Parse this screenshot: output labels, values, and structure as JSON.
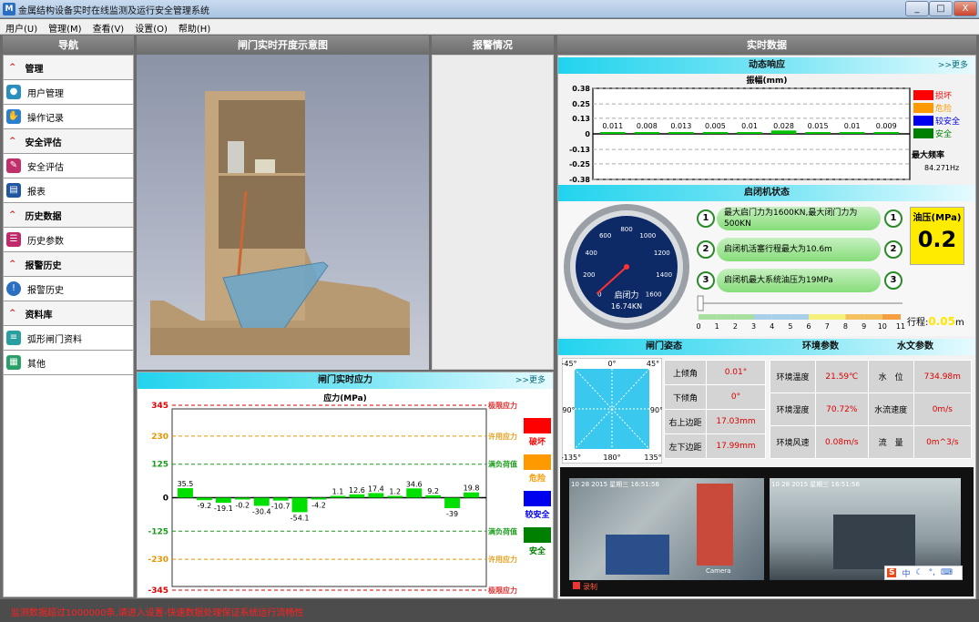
{
  "window": {
    "title": "金属结构设备实时在线监测及运行安全管理系统",
    "app_icon": "M",
    "min": "_",
    "max": "□",
    "close": "X"
  },
  "menu": [
    "用户(U)",
    "管理(M)",
    "查看(V)",
    "设置(O)",
    "帮助(H)"
  ],
  "headers": {
    "nav": "导航",
    "scene": "闸门实时开度示意图",
    "alarm": "报警情况",
    "realtime": "实时数据"
  },
  "nav": {
    "sections": [
      {
        "title": "管理",
        "items": [
          {
            "label": "用户管理",
            "icon": "user-icon"
          },
          {
            "label": "操作记录",
            "icon": "record-icon"
          }
        ]
      },
      {
        "title": "安全评估",
        "items": [
          {
            "label": "安全评估",
            "icon": "pencil-icon"
          }
        ]
      },
      {
        "title": "",
        "items": [
          {
            "label": "报表",
            "icon": "report-icon"
          }
        ]
      },
      {
        "title": "历史数据",
        "items": [
          {
            "label": "历史参数",
            "icon": "history-icon"
          }
        ]
      },
      {
        "title": "报警历史",
        "items": [
          {
            "label": "报警历史",
            "icon": "alarm-history-icon"
          }
        ]
      },
      {
        "title": "资料库",
        "items": [
          {
            "label": "弧形闸门资料",
            "icon": "doc-icon"
          },
          {
            "label": "其他",
            "icon": "other-icon"
          }
        ]
      }
    ]
  },
  "stress": {
    "header": "闸门实时应力",
    "more": ">>更多",
    "title": "应力(MPa)",
    "legend": [
      {
        "label": "破坏",
        "color": "#ff0000"
      },
      {
        "label": "危险",
        "color": "#ff9900"
      },
      {
        "label": "较安全",
        "color": "#0000ee"
      },
      {
        "label": "安全",
        "color": "#008000"
      }
    ],
    "lines": [
      {
        "label": "极限应力",
        "color": "#e03030"
      },
      {
        "label": "许用应力",
        "color": "#e8a020"
      },
      {
        "label": "满负荷值",
        "color": "#20a020"
      },
      {
        "label": "满负荷值",
        "color": "#20a020"
      },
      {
        "label": "许用应力",
        "color": "#e8a020"
      },
      {
        "label": "极限应力",
        "color": "#e03030"
      }
    ]
  },
  "chart_data": [
    {
      "type": "bar",
      "title": "应力(MPa)",
      "yticks": [
        "345",
        "230",
        "125",
        "0",
        "-125",
        "-230",
        "-345"
      ],
      "ylim": [
        -345,
        345
      ],
      "values": [
        35.5,
        -9.2,
        -19.1,
        -0.2,
        -30.4,
        -10.7,
        -54.1,
        -4.2,
        1.1,
        12.6,
        17.4,
        1.2,
        34.6,
        9.2,
        -39,
        19.8
      ],
      "labels": [
        "35.5",
        "-9.2",
        "-19.1",
        "-0.2",
        "-30.4",
        "-10.7",
        "-54.1",
        "-4.2",
        "1.1",
        "12.6",
        "17.4",
        "1.2",
        "34.6",
        "9.2",
        "-39",
        "19.8"
      ],
      "reference_lines": [
        345,
        230,
        125,
        -125,
        -230,
        -345
      ]
    },
    {
      "type": "bar",
      "title": "振幅(mm)",
      "yticks": [
        "0.38",
        "0.25",
        "0.13",
        "0",
        "-0.13",
        "-0.25",
        "-0.38"
      ],
      "ylim": [
        -0.38,
        0.38
      ],
      "values": [
        0.011,
        0.008,
        0.013,
        0.005,
        0.01,
        0.028,
        0.015,
        0.01,
        0.009
      ],
      "labels": [
        "0.011",
        "0.008",
        "0.013",
        "0.005",
        "0.01",
        "0.028",
        "0.015",
        "0.01",
        "0.009"
      ]
    }
  ],
  "dynamic": {
    "header": "动态响应",
    "more": ">>更多",
    "title": "振幅(mm)",
    "legend": [
      {
        "label": "损坏",
        "color": "#ff0000"
      },
      {
        "label": "危险",
        "color": "#ff9900"
      },
      {
        "label": "较安全",
        "color": "#0000ee"
      },
      {
        "label": "安全",
        "color": "#008000"
      }
    ],
    "freq_label": "最大频率",
    "freq_value": "84.271Hz"
  },
  "hoist": {
    "header": "启闭机状态",
    "gauge_label": "启闭力",
    "gauge_value": "16.74KN",
    "gauge_ticks": [
      "0",
      "200",
      "400",
      "600",
      "800",
      "1000",
      "1200",
      "1400",
      "1600"
    ],
    "info": [
      {
        "n": "1",
        "text": "最大启门力为1600KN,最大闭门力为500KN"
      },
      {
        "n": "2",
        "text": "启闭机活塞行程最大为10.6m"
      },
      {
        "n": "3",
        "text": "启闭机最大系统油压为19MPa"
      }
    ],
    "oil_label": "油压(MPa)",
    "oil_value": "0.2",
    "stroke_label": "行程:",
    "stroke_value": "0.05",
    "stroke_unit": "m",
    "stroke_fraction": 0.005,
    "scale": [
      "0",
      "1",
      "2",
      "3",
      "4",
      "5",
      "6",
      "7",
      "8",
      "9",
      "10",
      "11"
    ]
  },
  "posture": {
    "header": "闸门姿态",
    "angles": [
      "-45°",
      "0°",
      "45°",
      "-90°",
      "90°",
      "-135°",
      "180°",
      "135°"
    ],
    "rows": [
      {
        "label": "上倾角",
        "value": "0.01°"
      },
      {
        "label": "下倾角",
        "value": "0°"
      },
      {
        "label": "右上边距",
        "value": "17.03mm"
      },
      {
        "label": "左下边距",
        "value": "17.99mm"
      }
    ]
  },
  "env": {
    "header": "环境参数",
    "rows": [
      {
        "label": "环境温度",
        "value": "21.59℃"
      },
      {
        "label": "环境湿度",
        "value": "70.72%"
      },
      {
        "label": "环境风速",
        "value": "0.08m/s"
      }
    ]
  },
  "water": {
    "header": "水文参数",
    "rows": [
      {
        "label": "水　位",
        "value": "734.98m"
      },
      {
        "label": "水流速度",
        "value": "0m/s"
      },
      {
        "label": "流　量",
        "value": "0m^3/s"
      }
    ]
  },
  "cameras": [
    {
      "timestamp": "10 28 2015 星期三 16:51:56",
      "tag": "Camera"
    },
    {
      "timestamp": "10 28 2015 星期三 16:51:56"
    }
  ],
  "camera_rec": "录制",
  "tray": [
    "S",
    "中",
    "☾",
    "°,",
    "⌨"
  ],
  "status": "监测数据超过1000000条,请进入设置-快速数据处理保证系统运行流畅性"
}
